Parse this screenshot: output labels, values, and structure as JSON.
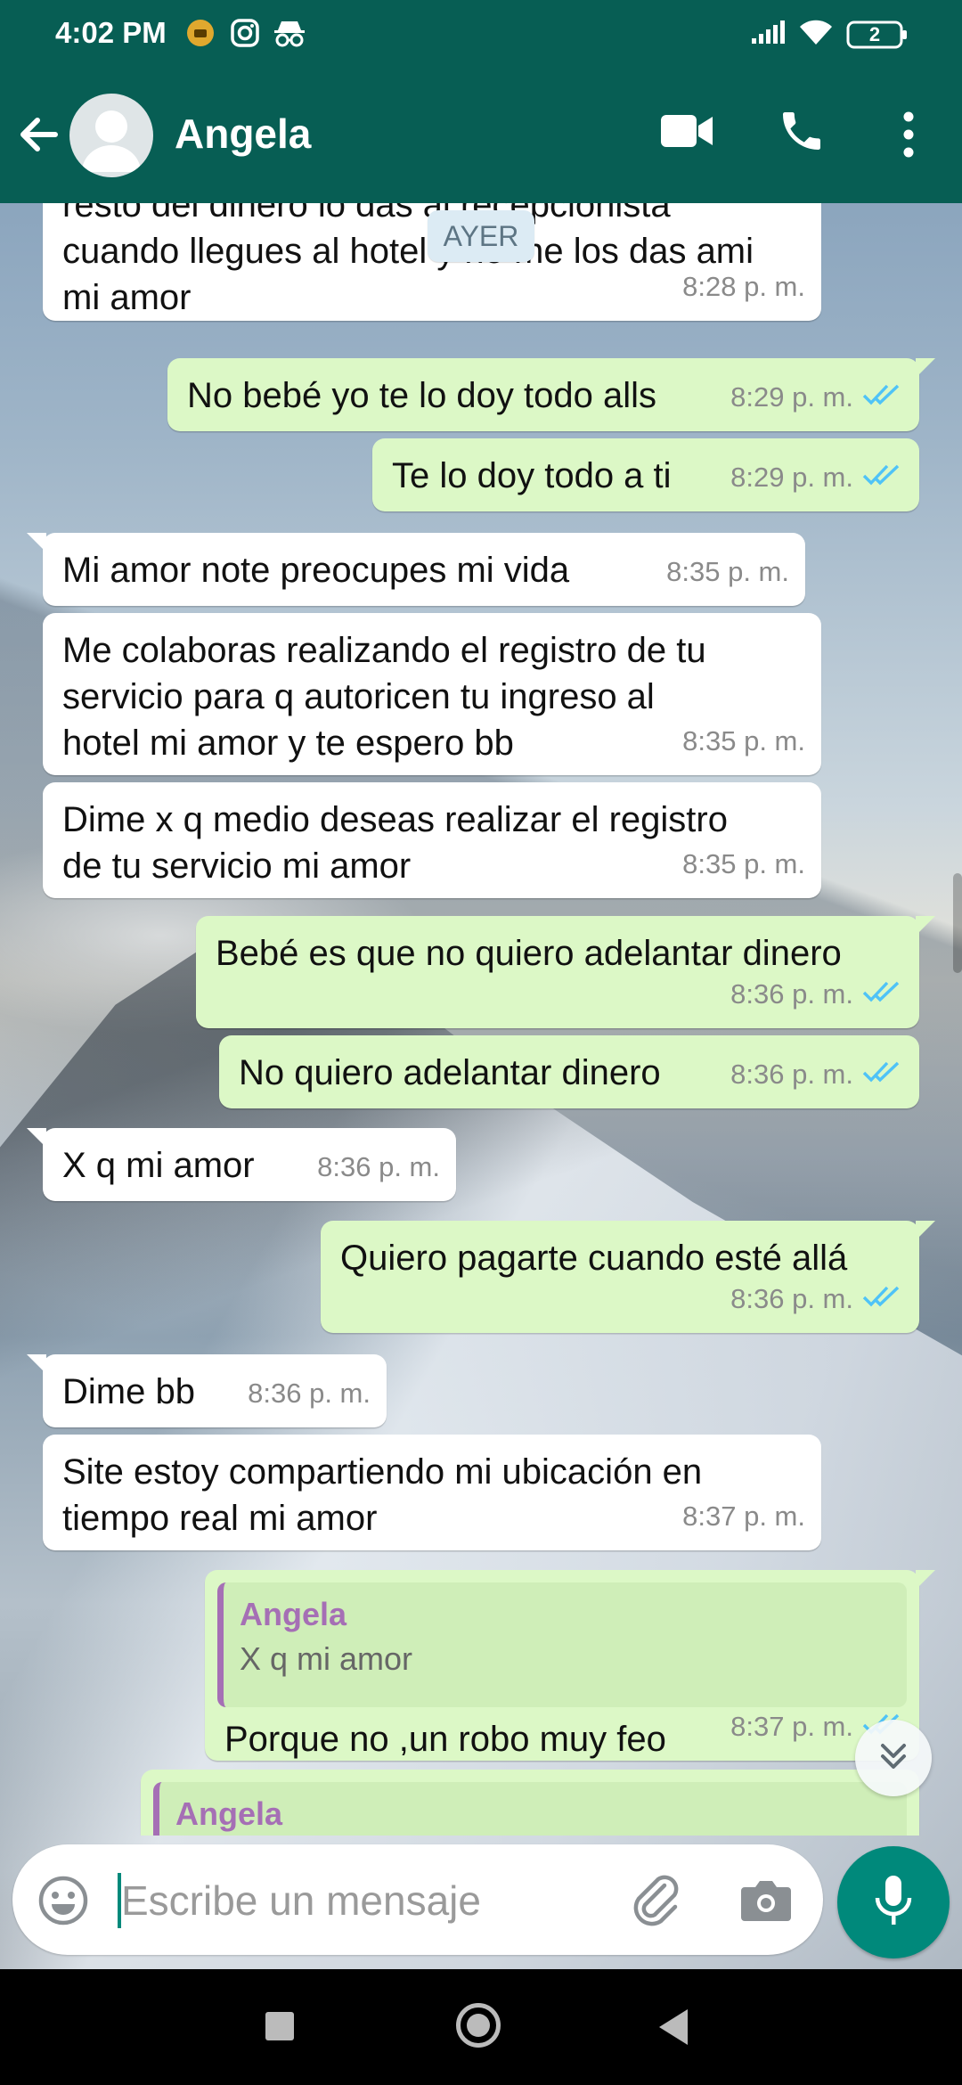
{
  "status_bar": {
    "time": "4:02 PM",
    "battery": "2"
  },
  "header": {
    "contact_name": "Angela"
  },
  "date_chip": "AYER",
  "messages": [
    {
      "dir": "in",
      "text": "resto del dinero lo das al recepcionista\ncuando llegues al hotel y no me los das ami\nmi amor",
      "time": "8:28 p. m."
    },
    {
      "dir": "out",
      "text": "No bebé yo te lo doy todo alls",
      "time": "8:29 p. m."
    },
    {
      "dir": "out",
      "text": "Te lo doy todo a ti",
      "time": "8:29 p. m."
    },
    {
      "dir": "in",
      "text": "Mi amor note preocupes mi vida",
      "time": "8:35 p. m."
    },
    {
      "dir": "in",
      "text": "Me colaboras realizando el registro de tu\nservicio para q autoricen tu ingreso al\nhotel mi amor y te espero bb",
      "time": "8:35 p. m."
    },
    {
      "dir": "in",
      "text": "Dime x q medio deseas realizar el registro\nde tu servicio mi amor",
      "time": "8:35 p. m."
    },
    {
      "dir": "out",
      "text": "Bebé es que no quiero adelantar dinero",
      "time": "8:36 p. m."
    },
    {
      "dir": "out",
      "text": "No quiero adelantar dinero",
      "time": "8:36 p. m."
    },
    {
      "dir": "in",
      "text": "X q mi amor",
      "time": "8:36 p. m."
    },
    {
      "dir": "out",
      "text": "Quiero pagarte cuando esté allá",
      "time": "8:36 p. m."
    },
    {
      "dir": "in",
      "text": "Dime bb",
      "time": "8:36 p. m."
    },
    {
      "dir": "in",
      "text": "Site estoy compartiendo mi ubicación en\ntiempo real mi amor",
      "time": "8:37 p. m."
    },
    {
      "dir": "out",
      "text": "Porque no ,un robo muy feo",
      "time": "8:37 p. m.",
      "quote_author": "Angela",
      "quote_text": "X q mi amor"
    },
    {
      "dir": "out",
      "quote_author": "Angela"
    }
  ],
  "composer": {
    "placeholder": "Escribe un mensaje"
  },
  "colors": {
    "header": "#075e54",
    "outgoing": "#dcf8c6",
    "incoming": "#ffffff",
    "accent": "#00897b",
    "read_ticks": "#4fc3f7",
    "quote_author": "#a56fb5"
  },
  "icons": [
    "back-arrow-icon",
    "video-call-icon",
    "voice-call-icon",
    "more-options-icon",
    "emoji-icon",
    "attach-icon",
    "camera-icon",
    "mic-icon",
    "scroll-down-icon"
  ]
}
